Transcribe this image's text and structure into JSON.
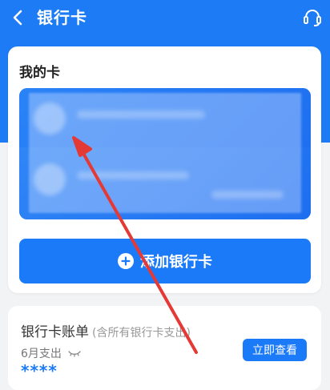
{
  "header": {
    "title": "银行卡",
    "back_icon": "chevron-left-icon",
    "service_icon": "headset-icon"
  },
  "my_cards": {
    "title": "我的卡",
    "add_button_label": "添加银行卡"
  },
  "bill": {
    "title": "银行卡账单",
    "subtitle": "(含所有银行卡支出)",
    "month_label": "6月支出",
    "amount": "****",
    "view_button_label": "立即查看"
  },
  "colors": {
    "primary": "#1a7af7",
    "header_bg": "#1d7bf5",
    "annotation_arrow": "#e53935"
  }
}
